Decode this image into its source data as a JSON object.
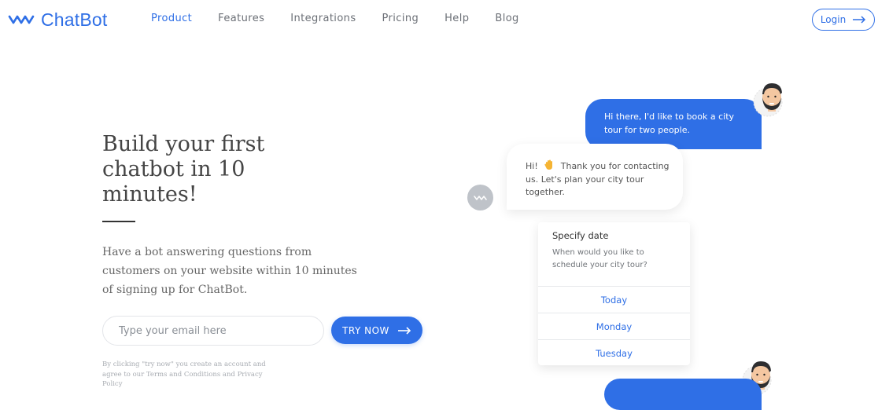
{
  "brand": {
    "name": "ChatBot",
    "accent": "#2f6fe6",
    "icon": "chatbot-wave-logo-icon"
  },
  "nav": {
    "items": [
      "Product",
      "Features",
      "Integrations",
      "Pricing",
      "Help",
      "Blog"
    ],
    "active": "Product",
    "login_label": "Login",
    "login_icon": "arrow-right-icon"
  },
  "hero": {
    "title": "Build your first chatbot in 10 minutes!",
    "description": "Have a bot answering questions from customers on your website within 10 minutes of signing up for ChatBot.",
    "email_placeholder": "Type your email here",
    "cta_label": "TRY NOW",
    "cta_icon": "arrow-right-icon",
    "legal": "By clicking \"try now\" you create an account and agree to our Terms and Conditions and Privacy Policy"
  },
  "chat": {
    "user_message": "Hi there, I'd like to book a city tour for two people.",
    "bot_message_start": "Hi!",
    "bot_emoji_icon": "waving-hand-icon",
    "bot_message": "Thank you for contacting us. Let's plan your city tour together.",
    "card": {
      "title": "Specify date",
      "question": "When would you like to schedule your city tour?",
      "options": [
        "Today",
        "Monday",
        "Tuesday"
      ]
    }
  }
}
